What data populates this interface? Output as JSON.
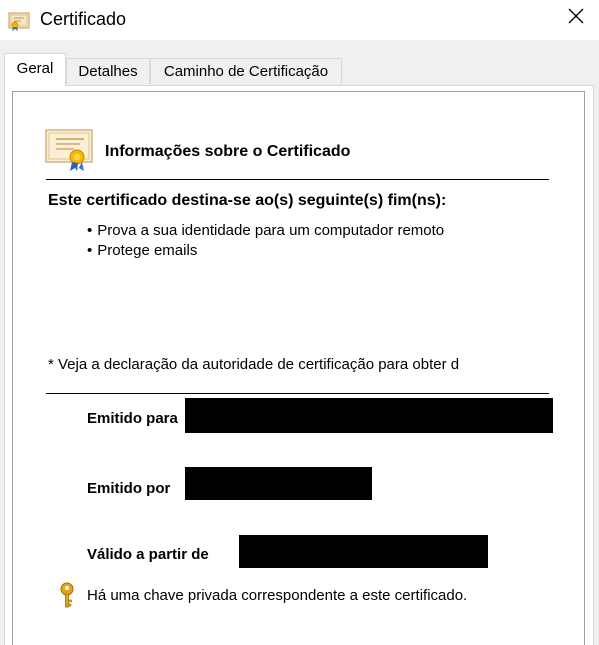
{
  "window": {
    "title": "Certificado",
    "icon": "certificate-icon",
    "close_icon": "close-icon"
  },
  "tabs": [
    {
      "label": "Geral",
      "active": true
    },
    {
      "label": "Detalhes",
      "active": false
    },
    {
      "label": "Caminho de Certificação",
      "active": false
    }
  ],
  "general": {
    "info_title": "Informações sobre o Certificado",
    "purpose_heading": "Este certificado destina-se ao(s) seguinte(s) fim(ns):",
    "purposes": [
      "Prova a sua identidade para um computador remoto",
      "Protege emails"
    ],
    "note": "* Veja a declaração da autoridade de certificação para obter d",
    "issued_to_label": "Emitido para",
    "issued_by_label": "Emitido por",
    "valid_from_label": "Válido a partir de",
    "private_key_text": "Há uma chave privada correspondente a este certificado."
  },
  "colors": {
    "background": "#f0f0f0",
    "panel": "#ffffff",
    "redaction": "#000000"
  }
}
